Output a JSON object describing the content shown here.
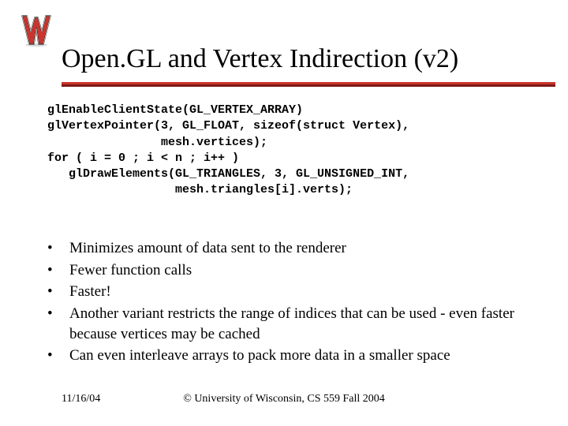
{
  "title": "Open.GL and Vertex Indirection (v2)",
  "code_lines": [
    "glEnableClientState(GL_VERTEX_ARRAY)",
    "glVertexPointer(3, GL_FLOAT, sizeof(struct Vertex),",
    "                mesh.vertices);",
    "for ( i = 0 ; i < n ; i++ )",
    "   glDrawElements(GL_TRIANGLES, 3, GL_UNSIGNED_INT,",
    "                  mesh.triangles[i].verts);"
  ],
  "bullets": [
    "Minimizes amount of data sent to the renderer",
    "Fewer function calls",
    "Faster!",
    "Another variant restricts the range of indices that can be used - even faster because vertices may be cached",
    "Can even interleave arrays to pack more data in a smaller space"
  ],
  "footer": {
    "date": "11/16/04",
    "copyright": "© University of Wisconsin, CS 559 Fall 2004"
  },
  "logo": {
    "letter": "W",
    "name": "wisconsin-w-logo"
  }
}
